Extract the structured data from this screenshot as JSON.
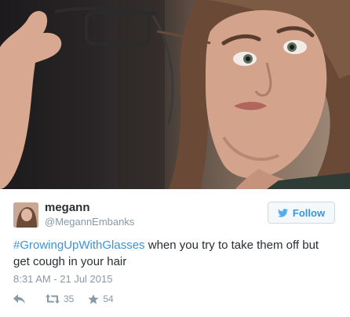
{
  "tweet": {
    "user": {
      "name": "megann",
      "handle": "@MegannEmbanks"
    },
    "follow_label": "Follow",
    "hashtag": "#GrowingUpWithGlasses",
    "text": " when you try to take them off but get cough in your hair",
    "timestamp": "8:31 AM - 21 Jul 2015",
    "retweet_count": "35",
    "favorite_count": "54"
  },
  "colors": {
    "link": "#3b94d9",
    "muted": "#8899a6",
    "text": "#292f33"
  },
  "icons": [
    "twitter-bird-icon",
    "reply-icon",
    "retweet-icon",
    "favorite-star-icon"
  ]
}
